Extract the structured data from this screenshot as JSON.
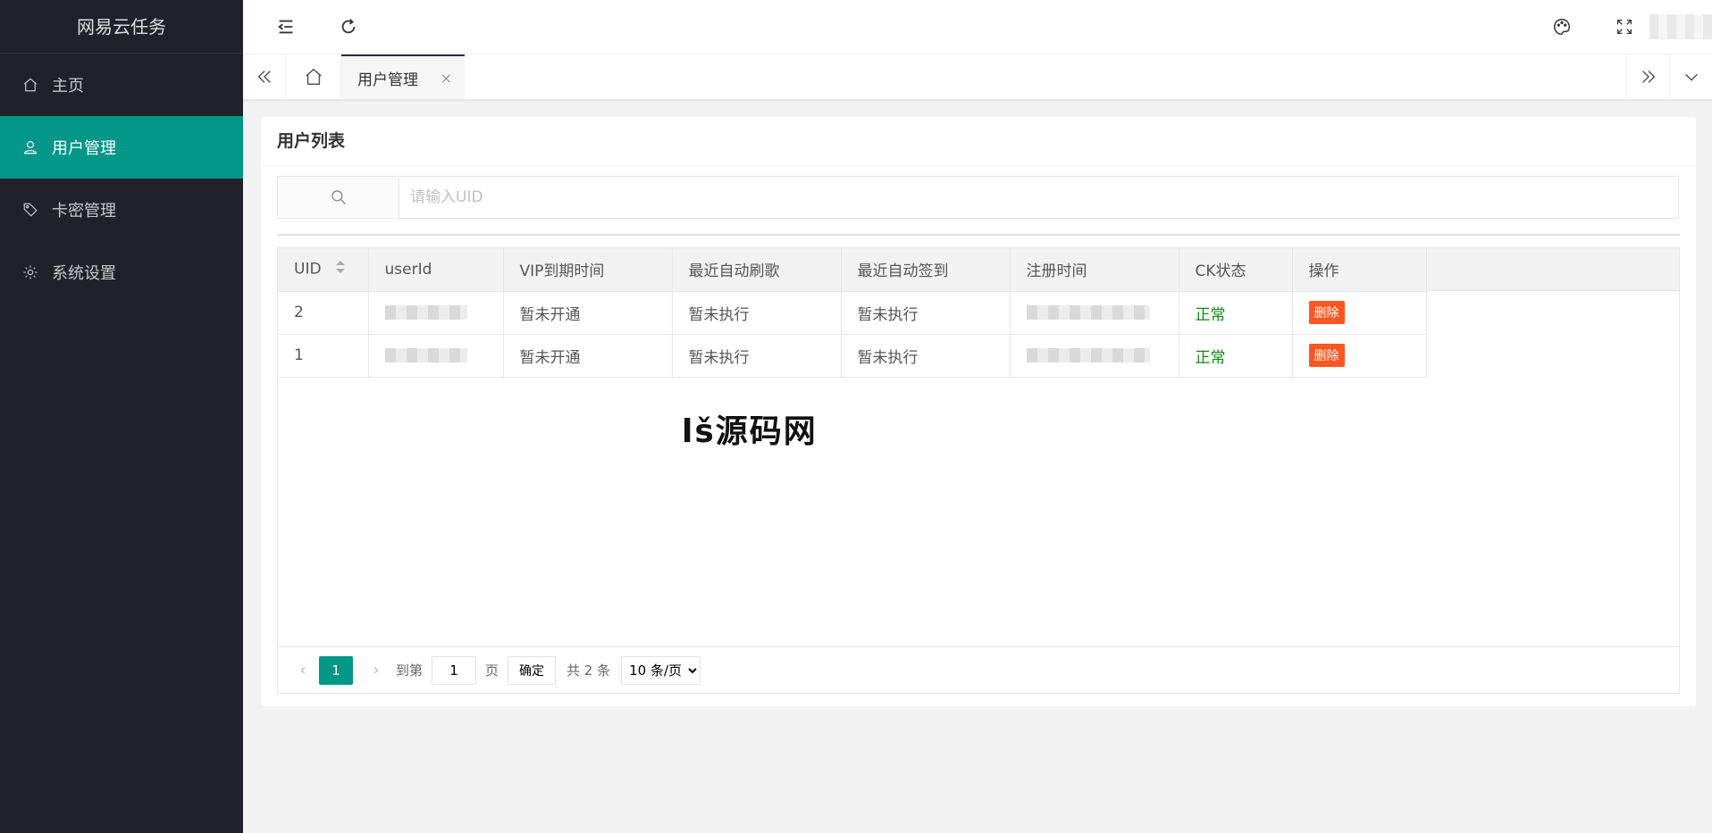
{
  "app": {
    "title": "网易云任务"
  },
  "sidebar": {
    "items": [
      {
        "label": "主页",
        "icon": "home-icon",
        "active": false
      },
      {
        "label": "用户管理",
        "icon": "user-icon",
        "active": true
      },
      {
        "label": "卡密管理",
        "icon": "tag-icon",
        "active": false
      },
      {
        "label": "系统设置",
        "icon": "gear-icon",
        "active": false
      }
    ]
  },
  "tabs": {
    "active_label": "用户管理",
    "close_glyph": "×"
  },
  "card": {
    "title": "用户列表"
  },
  "search": {
    "placeholder": "请输入UID",
    "value": ""
  },
  "table": {
    "columns": [
      "UID",
      "userId",
      "VIP到期时间",
      "最近自动刷歌",
      "最近自动签到",
      "注册时间",
      "CK状态",
      "操作"
    ],
    "rows": [
      {
        "uid": "2",
        "vip": "暂未开通",
        "auto_song": "暂未执行",
        "auto_sign": "暂未执行",
        "ck_status": "正常",
        "action": "删除"
      },
      {
        "uid": "1",
        "vip": "暂未开通",
        "auto_song": "暂未执行",
        "auto_sign": "暂未执行",
        "ck_status": "正常",
        "action": "删除"
      }
    ]
  },
  "watermark": {
    "text_black1": "lš",
    "text_blue": "",
    "text": "源码网"
  },
  "pagination": {
    "current": "1",
    "goto_label": "到第",
    "goto_value": "1",
    "page_label": "页",
    "confirm": "确定",
    "total": "共 2 条",
    "page_size": "10 条/页"
  },
  "colors": {
    "accent": "#009688",
    "danger": "#ff5722",
    "ok": "#118811",
    "sidebar_bg": "#20222a"
  }
}
